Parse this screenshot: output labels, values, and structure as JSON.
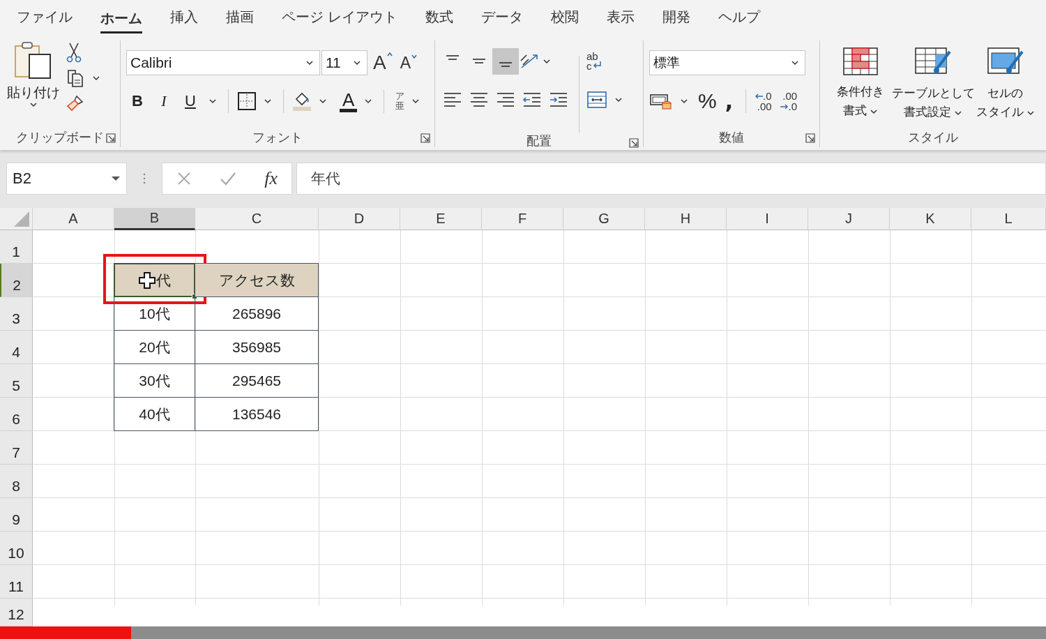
{
  "tabs": [
    {
      "label": "ファイル",
      "selected": false
    },
    {
      "label": "ホーム",
      "selected": true
    },
    {
      "label": "挿入",
      "selected": false
    },
    {
      "label": "描画",
      "selected": false
    },
    {
      "label": "ページ レイアウト",
      "selected": false
    },
    {
      "label": "数式",
      "selected": false
    },
    {
      "label": "データ",
      "selected": false
    },
    {
      "label": "校閲",
      "selected": false
    },
    {
      "label": "表示",
      "selected": false
    },
    {
      "label": "開発",
      "selected": false
    },
    {
      "label": "ヘルプ",
      "selected": false
    }
  ],
  "ribbon": {
    "clipboard": {
      "label": "クリップボード",
      "paste": "貼り付け"
    },
    "font": {
      "label": "フォント",
      "font_name": "Calibri",
      "font_size": "11",
      "grow": "A",
      "shrink": "A",
      "bold": "B",
      "italic": "I",
      "underline": "U",
      "font_color": "A",
      "phonetic": [
        "ア",
        "亜"
      ]
    },
    "alignment": {
      "label": "配置",
      "vertical": [
        {
          "kind": "top",
          "selected": false
        },
        {
          "kind": "middle",
          "selected": false
        },
        {
          "kind": "bottom",
          "selected": true
        }
      ],
      "wrap_text": [
        "ab",
        "c"
      ]
    },
    "number": {
      "label": "数値",
      "format": "標準",
      "percent": "%",
      "comma": ",",
      "increase_decimal": [
        ".0",
        ".00"
      ],
      "decrease_decimal": [
        ".00",
        ".0"
      ]
    },
    "styles": {
      "label": "スタイル",
      "buttons": [
        {
          "kind": "conditional",
          "lines": [
            "条件付き",
            "書式"
          ]
        },
        {
          "kind": "table",
          "lines": [
            "テーブルとして",
            "書式設定"
          ]
        },
        {
          "kind": "cell",
          "lines": [
            "セルの",
            "スタイル"
          ]
        }
      ]
    }
  },
  "formula_bar": {
    "name_box": "B2",
    "fx": "fx",
    "formula": "年代"
  },
  "sheet": {
    "columns": [
      {
        "label": "A",
        "selected": false
      },
      {
        "label": "B",
        "selected": true
      },
      {
        "label": "C",
        "selected": false
      },
      {
        "label": "D",
        "selected": false
      },
      {
        "label": "E",
        "selected": false
      },
      {
        "label": "F",
        "selected": false
      },
      {
        "label": "G",
        "selected": false
      },
      {
        "label": "H",
        "selected": false
      },
      {
        "label": "I",
        "selected": false
      },
      {
        "label": "J",
        "selected": false
      },
      {
        "label": "K",
        "selected": false
      },
      {
        "label": "L",
        "selected": false
      }
    ],
    "rows": [
      {
        "label": "1",
        "selected": false
      },
      {
        "label": "2",
        "selected": true
      },
      {
        "label": "3",
        "selected": false
      },
      {
        "label": "4",
        "selected": false
      },
      {
        "label": "5",
        "selected": false
      },
      {
        "label": "6",
        "selected": false
      },
      {
        "label": "7",
        "selected": false
      },
      {
        "label": "8",
        "selected": false
      },
      {
        "label": "9",
        "selected": false
      },
      {
        "label": "10",
        "selected": false
      },
      {
        "label": "11",
        "selected": false
      },
      {
        "label": "12",
        "selected": false
      }
    ],
    "table": {
      "header": [
        {
          "text": "代",
          "selected": true,
          "cursor": true,
          "annotated": true
        },
        {
          "text": "アクセス数",
          "selected": false,
          "cursor": false,
          "annotated": false
        }
      ],
      "rows": [
        [
          "10代",
          "265896"
        ],
        [
          "20代",
          "356985"
        ],
        [
          "30代",
          "295465"
        ],
        [
          "40代",
          "136546"
        ]
      ]
    }
  },
  "video_progress": {
    "level": 0.125
  }
}
